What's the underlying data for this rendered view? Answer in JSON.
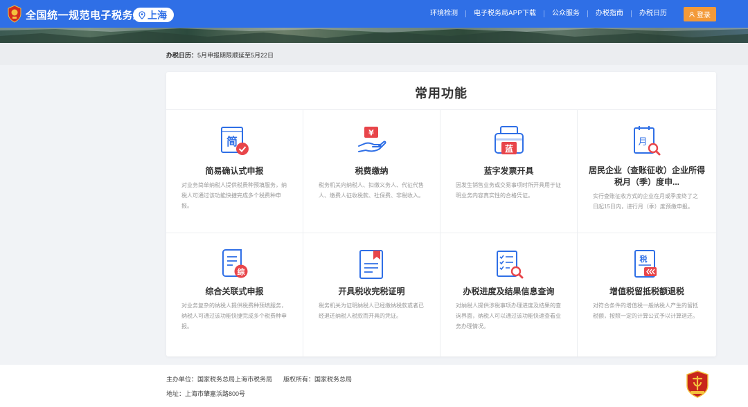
{
  "header": {
    "title": "全国统一规范电子税务局",
    "location": "上海",
    "nav": [
      "环境检测",
      "电子税务局APP下载",
      "公众服务",
      "办税指南",
      "办税日历"
    ],
    "login": "登录",
    "accent": "#2f6fe6",
    "login_color": "#f39a39"
  },
  "notice": {
    "label": "办税日历：",
    "text": "5月申报期限顺延至5月22日"
  },
  "functions": {
    "title": "常用功能",
    "items": [
      {
        "title": "简易确认式申报",
        "desc": "对业务简单纳税人提供税费种预填服务，纳税人可通过该功能快捷完成多个税费种申报。",
        "icon": "simple-declare-icon"
      },
      {
        "title": "税费缴纳",
        "desc": "税务机关向纳税人、扣缴义务人、代征代售人、缴费人征收税款、社保费、非税收入。",
        "icon": "tax-payment-icon"
      },
      {
        "title": "蓝字发票开具",
        "desc": "因发生销售业务或交易事项时所开具用于证明业务内容真实性的合格凭证。",
        "icon": "invoice-print-icon"
      },
      {
        "title": "居民企业（查账征收）企业所得税月（季）度申...",
        "desc": "实行查账征收方式的企业在月或季度终了之日起15日内，进行月（季）度预缴申报。",
        "icon": "monthly-declare-icon"
      },
      {
        "title": "综合关联式申报",
        "desc": "对业务复杂的纳税人提供税费种预填服务，纳税人可通过该功能快捷完成多个税费种申报。",
        "icon": "combined-declare-icon"
      },
      {
        "title": "开具税收完税证明",
        "desc": "税务机关为证明纳税人已经缴纳税款或者已经退还纳税人税款而开具的凭证。",
        "icon": "tax-certificate-icon"
      },
      {
        "title": "办税进度及结果信息查询",
        "desc": "对纳税人提供涉税事项办理进度及结果的查询界面，纳税人可以通过该功能快速查看业务办理情况。",
        "icon": "progress-query-icon"
      },
      {
        "title": "增值税留抵税额退税",
        "desc": "对符合条件的增值税一般纳税人产生的留抵税额，按照一定的计算公式予以计算退还。",
        "icon": "vat-refund-icon"
      }
    ],
    "icon_labels": [
      "简",
      "¥",
      "蓝",
      "月",
      "综",
      "",
      "",
      "税"
    ]
  },
  "footer": {
    "host": "主办单位：国家税务总局上海市税务局",
    "copyright": "版权所有：国家税务总局",
    "address": "地址：上海市肇嘉浜路800号"
  }
}
